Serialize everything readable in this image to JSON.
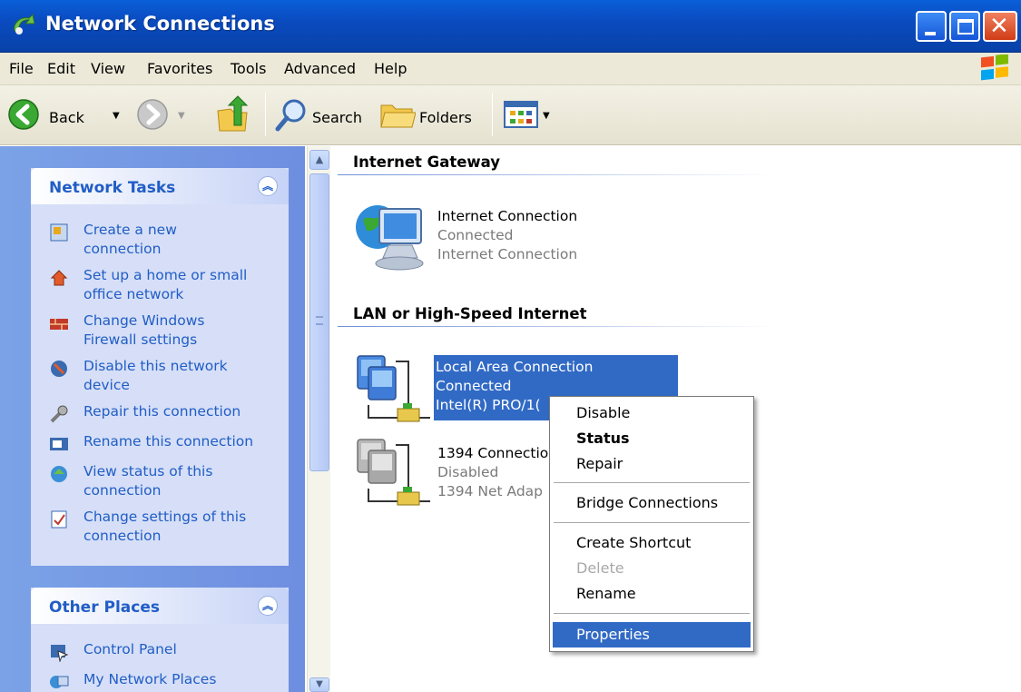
{
  "window": {
    "title": "Network Connections"
  },
  "menubar": {
    "items": [
      "File",
      "Edit",
      "View",
      "Favorites",
      "Tools",
      "Advanced",
      "Help"
    ]
  },
  "toolbar": {
    "back_label": "Back",
    "search_label": "Search",
    "folders_label": "Folders"
  },
  "network_tasks": {
    "title": "Network Tasks",
    "items": [
      {
        "label": "Create a new\nconnection",
        "icon": "new-connection-icon"
      },
      {
        "label": "Set up a home or small\noffice network",
        "icon": "home-network-icon"
      },
      {
        "label": "Change Windows\nFirewall settings",
        "icon": "firewall-icon"
      },
      {
        "label": "Disable this network\ndevice",
        "icon": "disable-device-icon"
      },
      {
        "label": "Repair this connection",
        "icon": "repair-icon"
      },
      {
        "label": "Rename this connection",
        "icon": "rename-icon"
      },
      {
        "label": "View status of this\nconnection",
        "icon": "status-icon"
      },
      {
        "label": "Change settings of this\nconnection",
        "icon": "settings-icon"
      }
    ]
  },
  "other_places": {
    "title": "Other Places",
    "items": [
      {
        "label": "Control Panel",
        "icon": "control-panel-icon"
      },
      {
        "label": "My Network Places",
        "icon": "network-places-icon"
      }
    ]
  },
  "groups": {
    "internet_gateway": {
      "title": "Internet Gateway",
      "item": {
        "name": "Internet Connection",
        "status": "Connected",
        "type": "Internet Connection"
      }
    },
    "lan": {
      "title": "LAN or High-Speed Internet",
      "items": [
        {
          "name": "Local Area Connection",
          "status": "Connected",
          "device": "Intel(R) PRO/1("
        },
        {
          "name": "1394 Connectio",
          "status": "Disabled",
          "device": "1394 Net Adap"
        }
      ]
    }
  },
  "context_menu": {
    "items": [
      "Disable",
      "Status",
      "Repair",
      "Bridge Connections",
      "Create Shortcut",
      "Delete",
      "Rename",
      "Properties"
    ]
  },
  "colors": {
    "titlebar": "#0a4bc0",
    "task_link": "#215dc6",
    "selection": "#316ac5",
    "pane": "#7ba2e7"
  }
}
